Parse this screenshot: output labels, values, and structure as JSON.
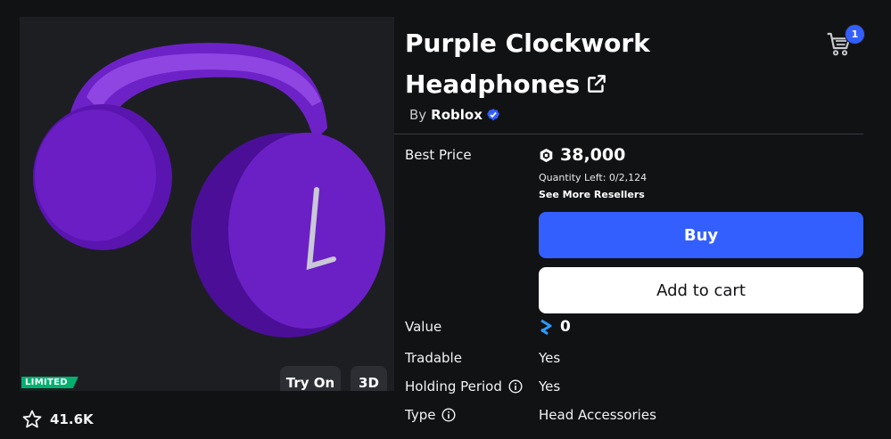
{
  "item": {
    "title_line1": "Purple Clockwork",
    "title_line2": "Headphones",
    "by_prefix": "By",
    "creator": "Roblox",
    "limited_badge": "LIMITED",
    "favorites": "41.6K"
  },
  "preview": {
    "try_on_label": "Try On",
    "view_3d_label": "3D",
    "colors": {
      "purple": "#6a1ec4",
      "purple_dark": "#4a0f96",
      "purple_light": "#8b3ce0"
    }
  },
  "cart": {
    "count": "1",
    "icon": "cart-icon"
  },
  "purchase": {
    "best_price_label": "Best Price",
    "price": "38,000",
    "quantity_left": "Quantity Left: 0/2,124",
    "see_more": "See More Resellers",
    "buy_label": "Buy",
    "add_to_cart_label": "Add to cart"
  },
  "details": {
    "value_label": "Value",
    "value": "0",
    "tradable_label": "Tradable",
    "tradable": "Yes",
    "holding_label": "Holding Period",
    "holding": "Yes",
    "type_label": "Type",
    "type": "Head Accessories"
  },
  "colors": {
    "accent": "#335fff",
    "limited": "#00b06f",
    "background": "#111214"
  }
}
